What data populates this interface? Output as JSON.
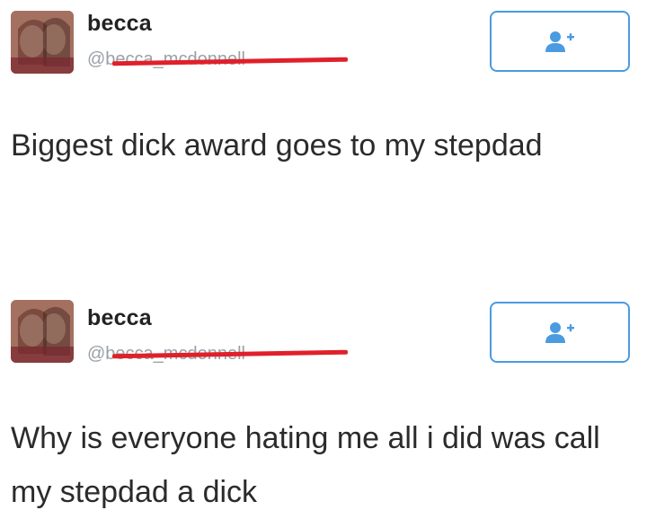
{
  "tweets": [
    {
      "user": {
        "display_name": "becca",
        "handle": "@becca_mcdonnell"
      },
      "follow_button": {
        "icon": "follow-user-icon",
        "color": "#4a9be0"
      },
      "text": "Biggest dick award goes to my stepdad"
    },
    {
      "user": {
        "display_name": "becca",
        "handle": "@becca_mcdonnell"
      },
      "follow_button": {
        "icon": "follow-user-icon",
        "color": "#4a9be0"
      },
      "text": "Why is everyone hating me all i did was call my stepdad a dick"
    }
  ],
  "colors": {
    "redaction": "#e0202a",
    "accent": "#4a9be0"
  }
}
